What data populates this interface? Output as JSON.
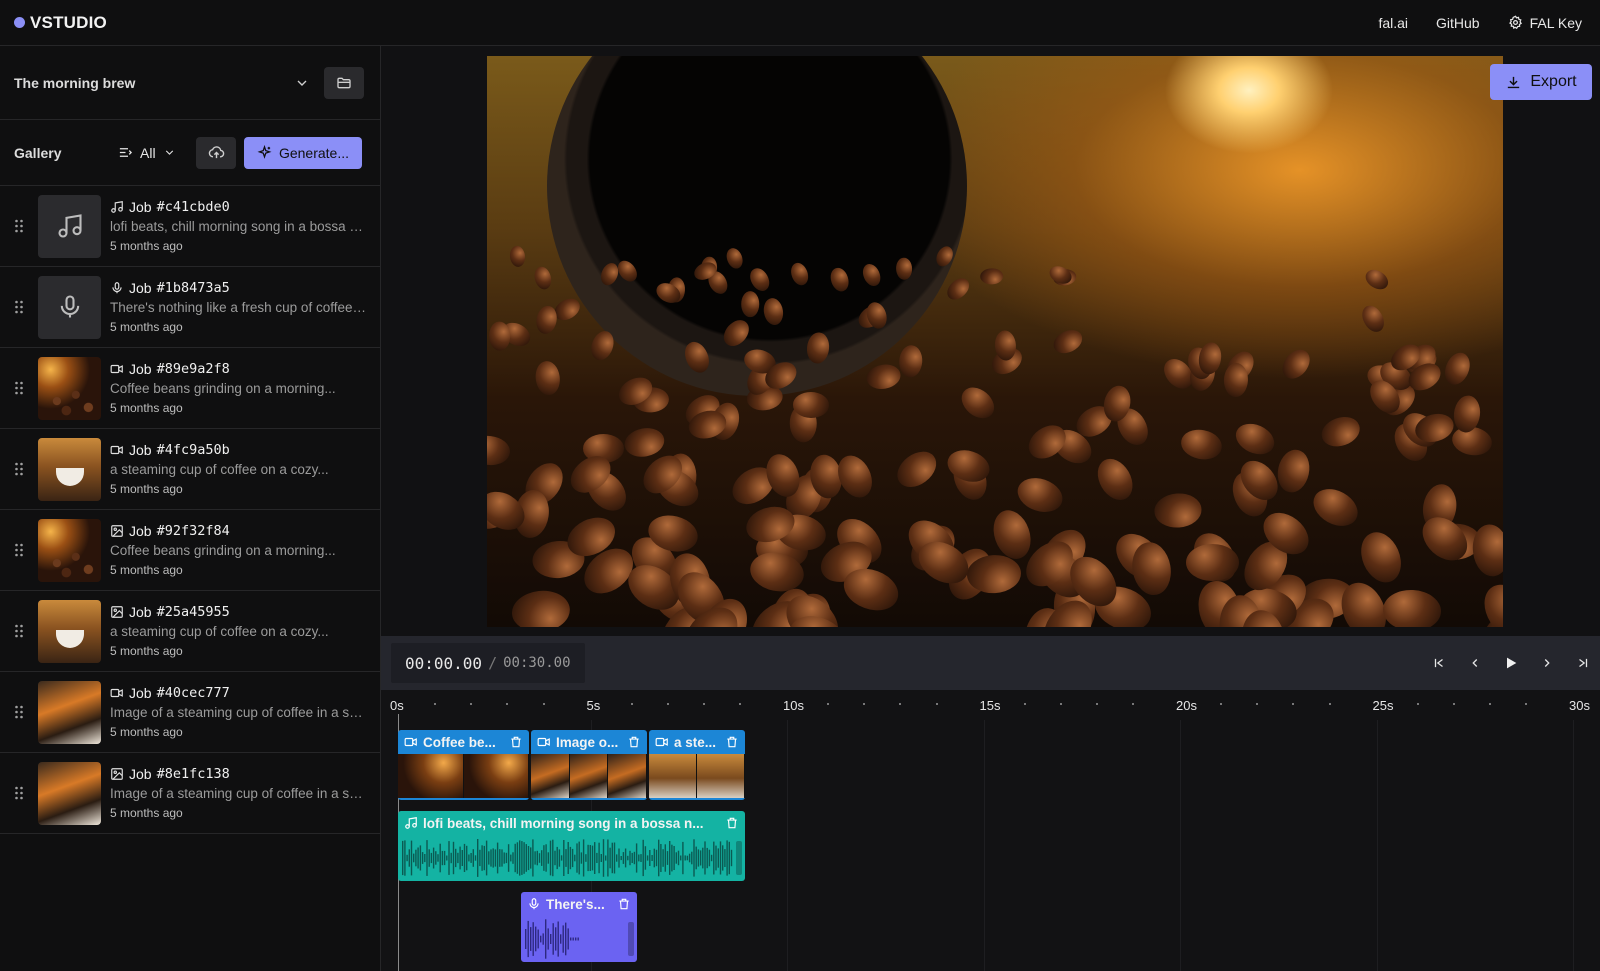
{
  "app": {
    "brand": "VSTUDIO"
  },
  "topnav": {
    "links": [
      "fal.ai",
      "GitHub",
      "FAL Key"
    ]
  },
  "project": {
    "name": "The morning brew"
  },
  "gallery": {
    "title": "Gallery",
    "filter": "All",
    "generate_label": "Generate..."
  },
  "jobs": [
    {
      "type": "music",
      "label": "Job",
      "id": "#c41cbde0",
      "desc": "lofi beats, chill morning song in a bossa nova style",
      "time": "5 months ago",
      "thumb": "music"
    },
    {
      "type": "voice",
      "label": "Job",
      "id": "#1b8473a5",
      "desc": "There's nothing like a fresh cup of coffee in the morning",
      "time": "5 months ago",
      "thumb": "voice"
    },
    {
      "type": "video",
      "label": "Job",
      "id": "#89e9a2f8",
      "desc": "Coffee beans grinding on a morning...",
      "time": "5 months ago",
      "thumb": "beans"
    },
    {
      "type": "video",
      "label": "Job",
      "id": "#4fc9a50b",
      "desc": "a steaming cup of coffee on a cozy...",
      "time": "5 months ago",
      "thumb": "cup"
    },
    {
      "type": "image",
      "label": "Job",
      "id": "#92f32f84",
      "desc": "Coffee beans grinding on a morning...",
      "time": "5 months ago",
      "thumb": "beans"
    },
    {
      "type": "image",
      "label": "Job",
      "id": "#25a45955",
      "desc": "a steaming cup of coffee on a cozy...",
      "time": "5 months ago",
      "thumb": "cup"
    },
    {
      "type": "video",
      "label": "Job",
      "id": "#40cec777",
      "desc": "Image of a steaming cup of coffee in a sunlit kitchen",
      "time": "5 months ago",
      "thumb": "shelf"
    },
    {
      "type": "image",
      "label": "Job",
      "id": "#8e1fc138",
      "desc": "Image of a steaming cup of coffee in a sunlit kitchen",
      "time": "5 months ago",
      "thumb": "shelf"
    }
  ],
  "preview": {
    "export_label": "Export"
  },
  "transport": {
    "current": "00:00.00",
    "separator": "/",
    "total": "00:30.00"
  },
  "timeline": {
    "ticks": [
      "0s",
      "5s",
      "10s",
      "15s",
      "20s",
      "25s",
      "30s"
    ],
    "clips": {
      "video": [
        {
          "title": "Coffee be..."
        },
        {
          "title": "Image o..."
        },
        {
          "title": "a ste..."
        }
      ],
      "music": {
        "title": "lofi beats, chill morning song in a bossa n..."
      },
      "voice": {
        "title": "There's..."
      }
    }
  },
  "colors": {
    "accent": "#8b8ff7",
    "video_track": "#1c86d6",
    "music_track": "#14b3a3",
    "voice_track": "#6b63f2"
  }
}
